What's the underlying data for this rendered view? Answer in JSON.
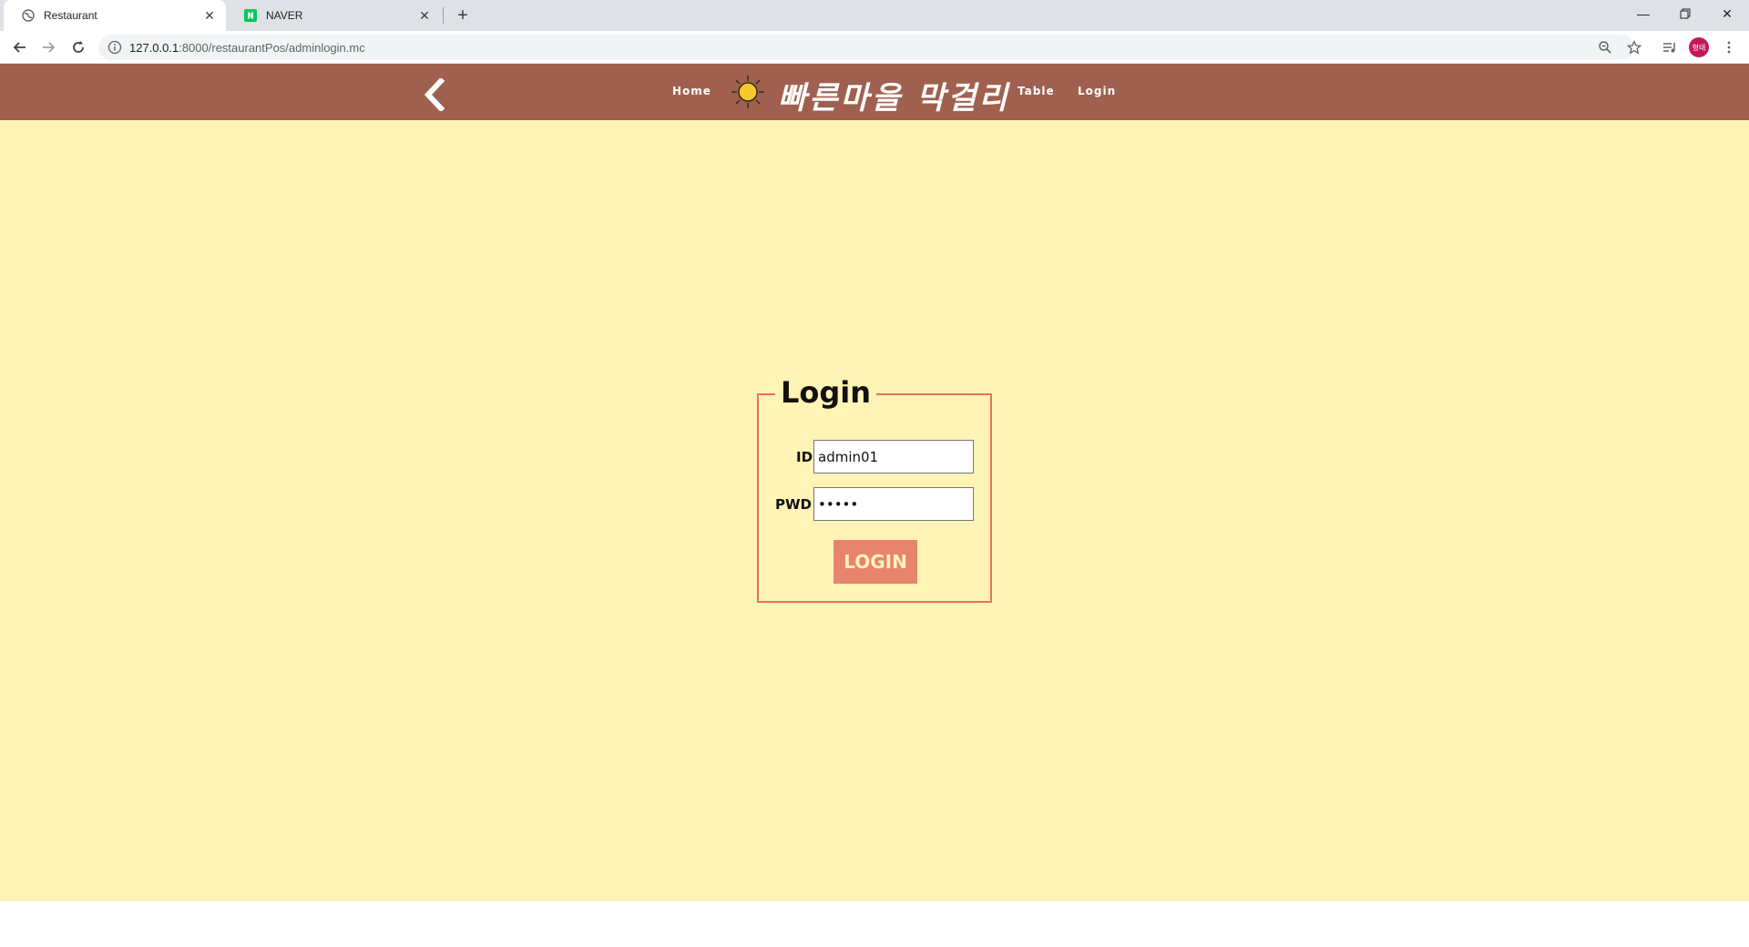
{
  "browser": {
    "tabs": [
      {
        "title": "Restaurant",
        "active": true
      },
      {
        "title": "NAVER",
        "active": false
      }
    ],
    "url_host": "127.0.0.1",
    "url_rest": ":8000/restaurantPos/adminlogin.mc",
    "profile_initials": "형태"
  },
  "header": {
    "nav_home": "Home",
    "brand": "빠른마을 막걸리",
    "nav_table": "Table",
    "nav_login": "Login"
  },
  "login": {
    "legend": "Login",
    "id_label": "ID",
    "id_value": "admin01",
    "pwd_label": "PWD",
    "pwd_value": "•••••",
    "button_label": "LOGIN"
  },
  "colors": {
    "header": "#a0604f",
    "page_bg": "#fff3b5",
    "accent": "#e8846e",
    "border": "#e8715f"
  }
}
